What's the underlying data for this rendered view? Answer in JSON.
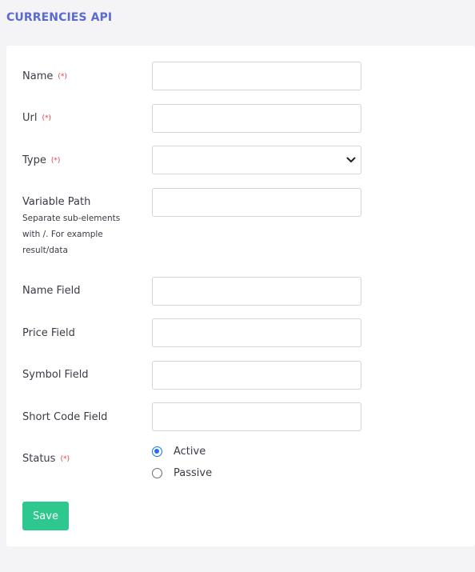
{
  "header": {
    "title": "CURRENCIES API"
  },
  "required_mark": "(*)",
  "form": {
    "name": {
      "label": "Name",
      "value": ""
    },
    "url": {
      "label": "Url",
      "value": ""
    },
    "type": {
      "label": "Type",
      "value": ""
    },
    "variable_path": {
      "label": "Variable Path",
      "help": "Separate sub-elements with /. For example result/data",
      "value": ""
    },
    "name_field": {
      "label": "Name Field",
      "value": ""
    },
    "price_field": {
      "label": "Price Field",
      "value": ""
    },
    "symbol_field": {
      "label": "Symbol Field",
      "value": ""
    },
    "short_code_field": {
      "label": "Short Code Field",
      "value": ""
    },
    "status": {
      "label": "Status",
      "options": [
        {
          "label": "Active",
          "selected": true
        },
        {
          "label": "Passive",
          "selected": false
        }
      ]
    }
  },
  "actions": {
    "save_label": "Save"
  },
  "colors": {
    "title": "#5b6ad0",
    "required": "#e0404a",
    "save_button": "#2ec78e",
    "radio_active": "#1a73e8"
  }
}
